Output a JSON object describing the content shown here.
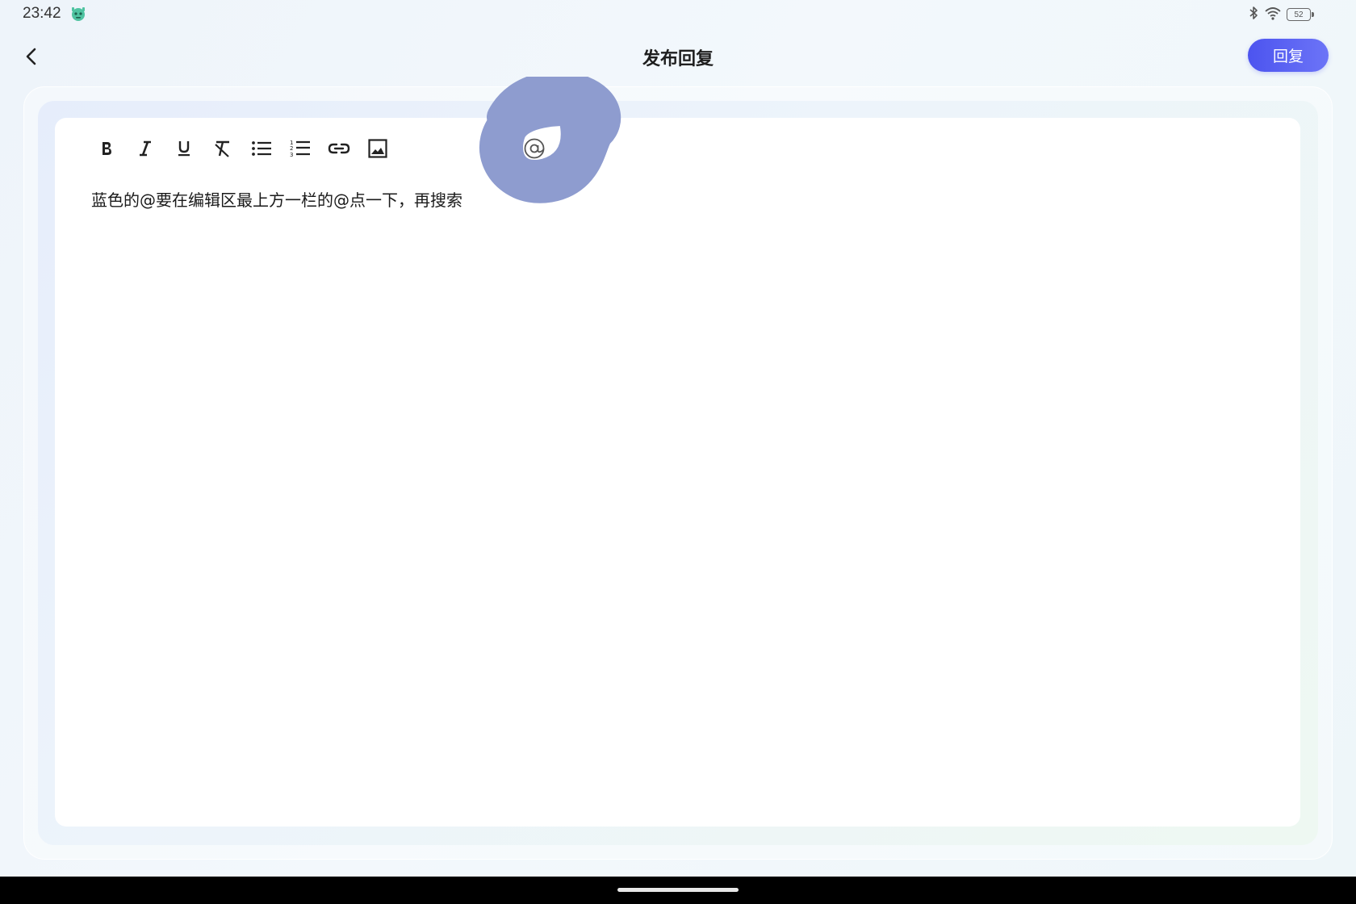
{
  "status_bar": {
    "time": "23:42",
    "app_icon": "robot-icon",
    "battery_level": "52",
    "bluetooth_icon": "bluetooth-icon",
    "wifi_icon": "wifi-icon"
  },
  "header": {
    "back_icon": "chevron-left-icon",
    "title": "发布回复",
    "reply_label": "回复",
    "reply_color": "#5058f0"
  },
  "editor": {
    "toolbar": [
      {
        "name": "bold",
        "icon": "bold-icon"
      },
      {
        "name": "italic",
        "icon": "italic-icon"
      },
      {
        "name": "underline",
        "icon": "underline-icon"
      },
      {
        "name": "clear-format",
        "icon": "clear-format-icon"
      },
      {
        "name": "bullet-list",
        "icon": "bullet-list-icon"
      },
      {
        "name": "numbered-list",
        "icon": "numbered-list-icon"
      },
      {
        "name": "link",
        "icon": "link-icon"
      },
      {
        "name": "image",
        "icon": "image-icon"
      },
      {
        "name": "mention",
        "icon": "at-icon",
        "label": "@"
      }
    ],
    "content": "蓝色的@要在编辑区最上方一栏的@点一下，再搜索"
  },
  "annotation": {
    "color": "#8e9ccf"
  }
}
